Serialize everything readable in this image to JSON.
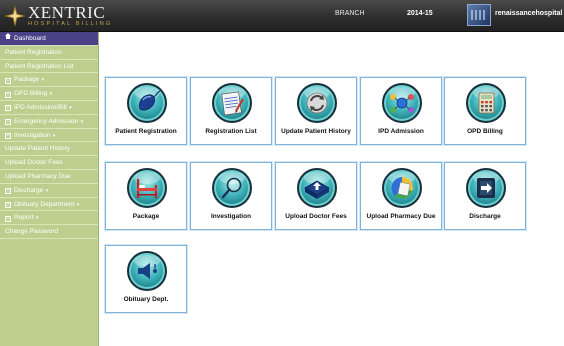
{
  "header": {
    "brand_title": "XENTRIC",
    "brand_subtitle": "HOSPITAL BILLING",
    "branch_label": "BRANCH",
    "financial_year": "2014-15",
    "username": "renaissancehospital"
  },
  "sidebar": {
    "items": [
      {
        "label": "Dashboard",
        "icon": "home-icon",
        "active": true,
        "has_caret": false
      },
      {
        "label": "Patient Registration",
        "icon": "",
        "active": false,
        "has_caret": false
      },
      {
        "label": "Patient Registration List",
        "icon": "",
        "active": false,
        "has_caret": false
      },
      {
        "label": "Package",
        "icon": "plus-box-icon",
        "active": false,
        "has_caret": true
      },
      {
        "label": "OPD Billing",
        "icon": "plus-box-icon",
        "active": false,
        "has_caret": true
      },
      {
        "label": "IPD Admission/Bill",
        "icon": "plus-box-icon",
        "active": false,
        "has_caret": true
      },
      {
        "label": "Emergency Admission",
        "icon": "plus-box-icon",
        "active": false,
        "has_caret": true
      },
      {
        "label": "Investigation",
        "icon": "plus-box-icon",
        "active": false,
        "has_caret": true
      },
      {
        "label": "Update Patient History",
        "icon": "",
        "active": false,
        "has_caret": false
      },
      {
        "label": "Upload Doctor Fees",
        "icon": "",
        "active": false,
        "has_caret": false
      },
      {
        "label": "Upload Pharmacy Due",
        "icon": "",
        "active": false,
        "has_caret": false
      },
      {
        "label": "Discharge",
        "icon": "plus-box-icon",
        "active": false,
        "has_caret": true
      },
      {
        "label": "Obituary Department",
        "icon": "plus-box-icon",
        "active": false,
        "has_caret": true
      },
      {
        "label": "Report",
        "icon": "plus-box-icon",
        "active": false,
        "has_caret": true
      },
      {
        "label": "Change Password",
        "icon": "",
        "active": false,
        "has_caret": false
      }
    ]
  },
  "tiles": [
    {
      "label": "Patient Registration",
      "icon": "mouse-icon"
    },
    {
      "label": "Registration List",
      "icon": "notepad-icon"
    },
    {
      "label": "Update Patient History",
      "icon": "refresh-icon"
    },
    {
      "label": "IPD Admission",
      "icon": "network-icon"
    },
    {
      "label": "OPD Billing",
      "icon": "calculator-icon"
    },
    {
      "label": "Package",
      "icon": "bed-icon"
    },
    {
      "label": "Investigation",
      "icon": "magnifier-icon"
    },
    {
      "label": "Upload Doctor Fees",
      "icon": "upload-icon"
    },
    {
      "label": "Upload Pharmacy Due",
      "icon": "pie-chart-icon"
    },
    {
      "label": "Discharge",
      "icon": "exit-icon"
    },
    {
      "label": "Obituary Dept.",
      "icon": "speaker-icon"
    }
  ],
  "colors": {
    "header_bg": "#2c2c2c",
    "sidebar_bg": "#bccf8e",
    "sidebar_active": "#4a4189",
    "tile_border": "#7fb3d8",
    "icon_teal": "#3fb3ba"
  }
}
